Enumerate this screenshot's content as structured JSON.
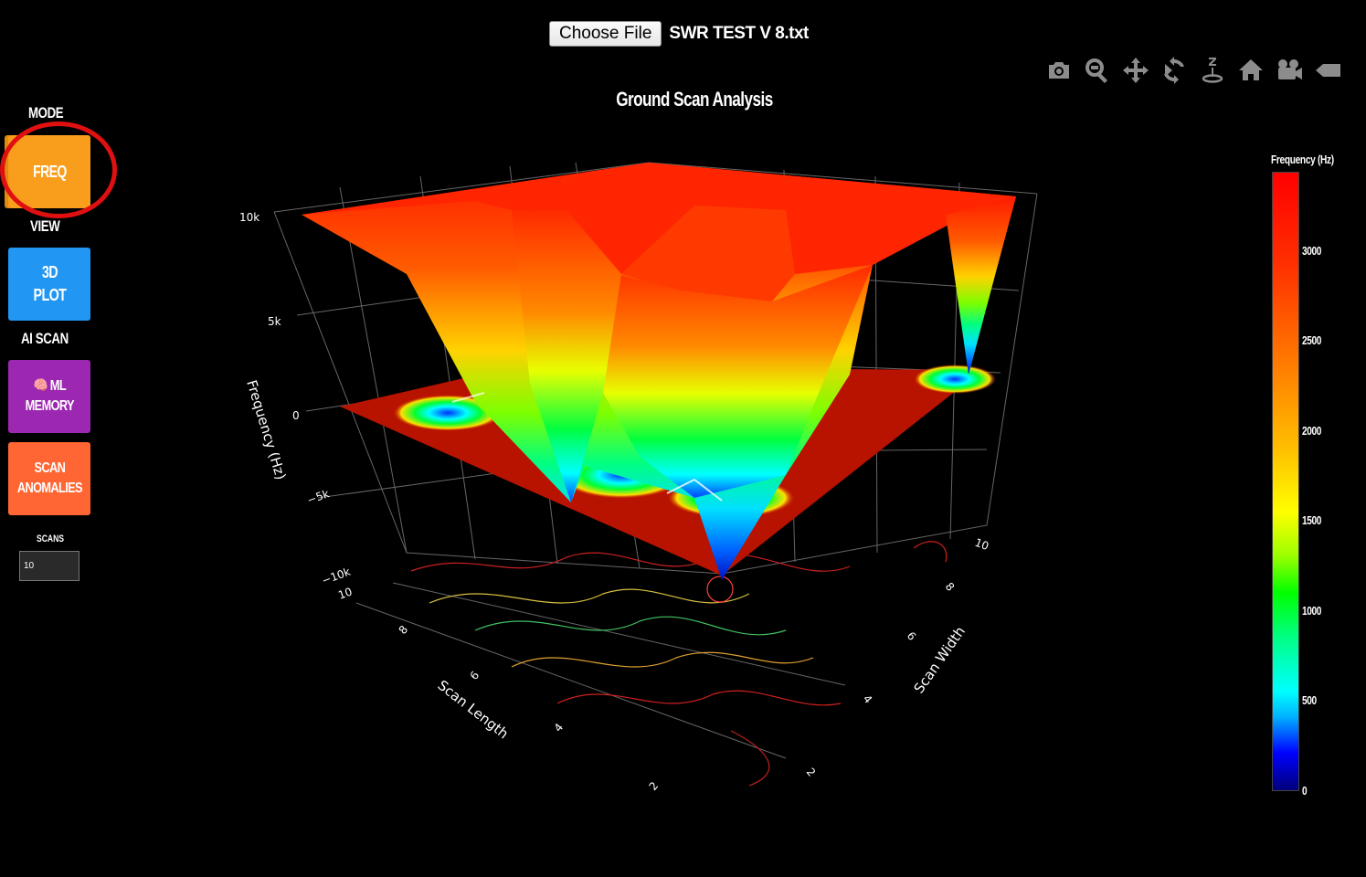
{
  "file_input": {
    "button_label": "Choose File",
    "file_name": "SWR TEST V 8.txt"
  },
  "toolbar": {
    "icons": [
      "camera-icon",
      "zoom-icon",
      "pan-icon",
      "orbit-rotation-icon",
      "turntable-rotation-icon",
      "reset-home-icon",
      "reset-camera-icon",
      "toggle-hover-icon"
    ]
  },
  "sidebar": {
    "mode_label": "MODE",
    "freq_button": "FREQ",
    "view_label": "VIEW",
    "plot_button_line1": "3D",
    "plot_button_line2": "PLOT",
    "ai_label": "AI SCAN",
    "ml_button_line1": "🧠 ML",
    "ml_button_line2": "MEMORY",
    "anom_button_line1": "SCAN",
    "anom_button_line2": "ANOMALIES",
    "scans_label": "SCANS",
    "scans_value": "10"
  },
  "colors": {
    "freq": "#f99d1c",
    "plot": "#2196f3",
    "ml": "#9c27b0",
    "anomalies": "#ff6633",
    "highlight": "#e01010"
  },
  "chart_data": {
    "type": "surface",
    "title": "Ground Scan Analysis",
    "zlabel": "Frequency (Hz)",
    "xlabel": "Scan Length",
    "ylabel": "Scan Width",
    "z_ticks": [
      "10k",
      "5k",
      "0",
      "−5k",
      "−10k"
    ],
    "x_ticks": [
      "10",
      "8",
      "6",
      "4",
      "2"
    ],
    "y_ticks": [
      "10",
      "8",
      "6",
      "4",
      "2"
    ],
    "colorbar": {
      "title": "Frequency (Hz)",
      "ticks": [
        "3000",
        "2500",
        "2000",
        "1500",
        "1000",
        "500",
        "0"
      ],
      "range": [
        0,
        3400
      ],
      "colorscale": "jet-like (blue to red)"
    }
  }
}
